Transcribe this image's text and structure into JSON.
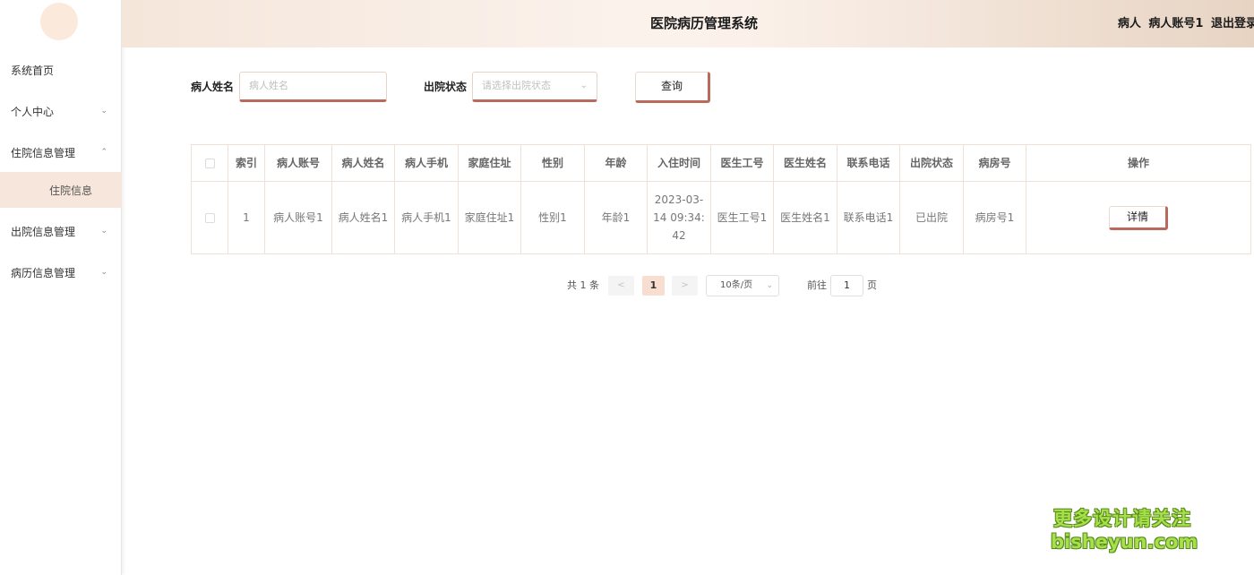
{
  "app": {
    "title": "医院病历管理系统"
  },
  "header": {
    "role": "病人",
    "username": "病人账号1",
    "logout": "退出登录"
  },
  "sidebar": {
    "items": [
      {
        "label": "系统首页"
      },
      {
        "label": "个人中心",
        "icon": "chevron-down-icon",
        "chevron": "⌄"
      },
      {
        "label": "住院信息管理",
        "icon": "chevron-up-icon",
        "chevron": "⌃"
      },
      {
        "label": "住院信息"
      },
      {
        "label": "出院信息管理",
        "icon": "chevron-down-icon",
        "chevron": "⌄"
      },
      {
        "label": "病历信息管理",
        "icon": "chevron-down-icon",
        "chevron": "⌄"
      }
    ]
  },
  "search": {
    "name_label": "病人姓名",
    "name_placeholder": "病人姓名",
    "status_label": "出院状态",
    "status_placeholder": "请选择出院状态",
    "query_button": "查询"
  },
  "table": {
    "columns": [
      "索引",
      "病人账号",
      "病人姓名",
      "病人手机",
      "家庭住址",
      "性别",
      "年龄",
      "入住时间",
      "医生工号",
      "医生姓名",
      "联系电话",
      "出院状态",
      "病房号",
      "操作"
    ],
    "rows": [
      {
        "index": "1",
        "account": "病人账号1",
        "name": "病人姓名1",
        "phone": "病人手机1",
        "address": "家庭住址1",
        "gender": "性别1",
        "age": "年龄1",
        "checkin_time": "2023-03-14 09:34:42",
        "doctor_id": "医生工号1",
        "doctor_name": "医生姓名1",
        "contact": "联系电话1",
        "discharge_status": "已出院",
        "room": "病房号1",
        "action": "详情"
      }
    ]
  },
  "pagination": {
    "total": "共 1 条",
    "prev": "<",
    "current": "1",
    "next": ">",
    "page_size": "10条/页",
    "goto_label": "前往",
    "goto_value": "1",
    "goto_suffix": "页"
  },
  "watermark": {
    "line1": "更多设计请关注",
    "line2": "bisheyun.com"
  },
  "colors": {
    "accent": "#b96a5c",
    "header_bg": "#f5e6da",
    "active_sub": "#f7e6db",
    "page_active": "#f7ded0"
  }
}
